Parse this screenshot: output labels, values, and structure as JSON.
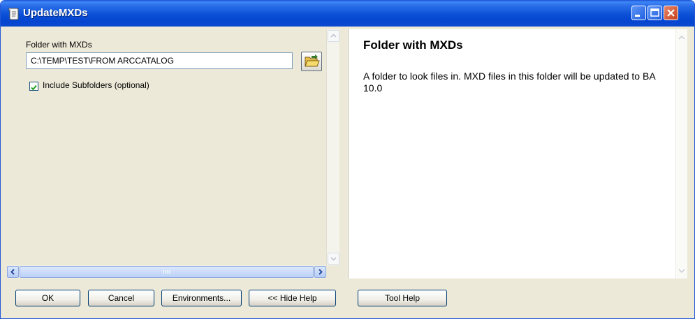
{
  "window": {
    "title": "UpdateMXDs",
    "icon": "python-script-icon"
  },
  "form": {
    "folder_label": "Folder with MXDs",
    "folder_value": "C:\\TEMP\\TEST\\FROM ARCCATALOG",
    "browse_icon": "open-folder-icon",
    "subfolders_label": "Include Subfolders (optional)",
    "subfolders_checked": true
  },
  "help": {
    "title": "Folder with MXDs",
    "text": "A folder to look files in. MXD files in this folder will be updated to BA 10.0"
  },
  "buttons": {
    "ok": "OK",
    "cancel": "Cancel",
    "environments": "Environments...",
    "hide_help": "<< Hide Help",
    "tool_help": "Tool Help"
  },
  "colors": {
    "titlebar": "#0a4fd6",
    "dialog_bg": "#ece9d8",
    "close_button": "#c5401a"
  }
}
